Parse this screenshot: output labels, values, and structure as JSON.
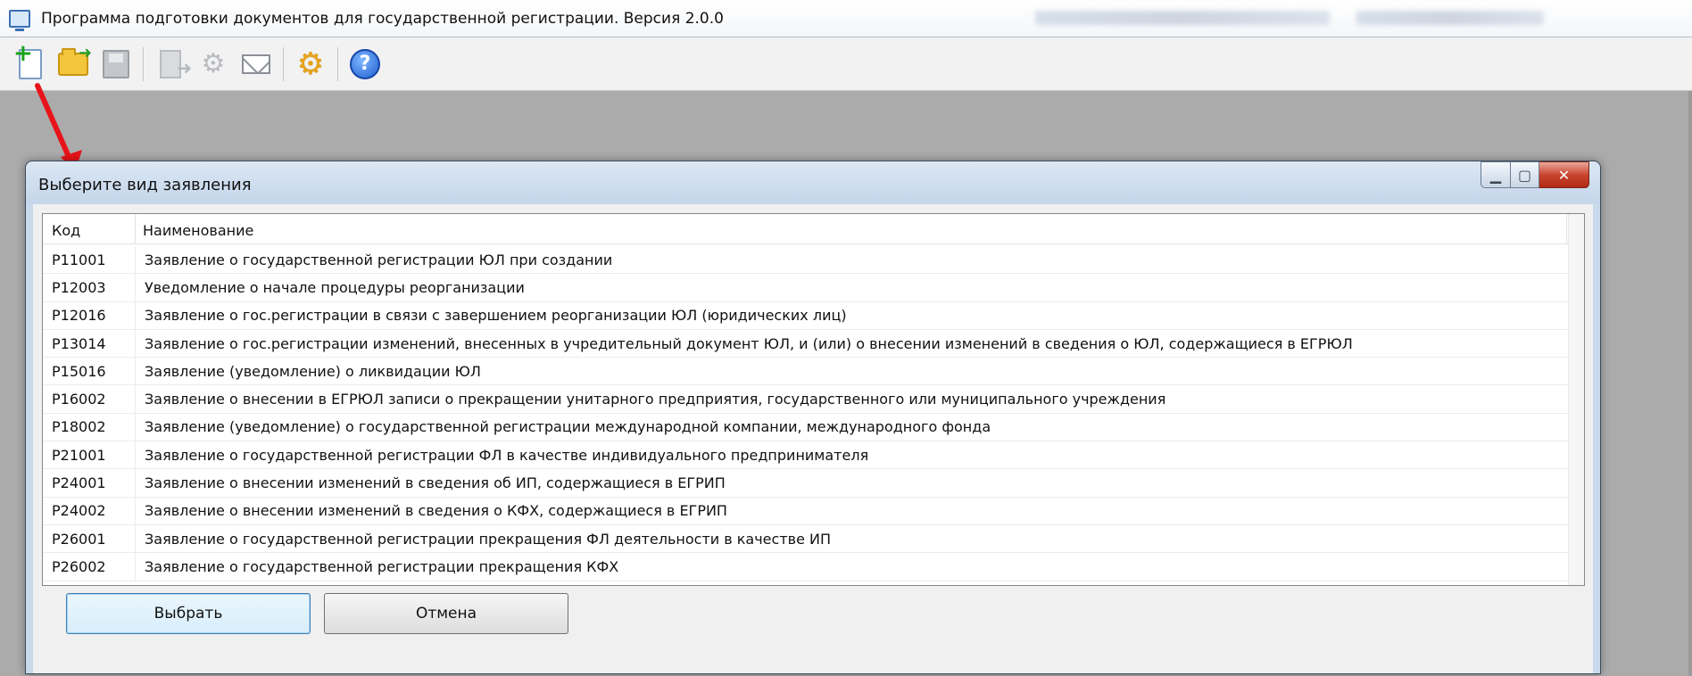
{
  "app": {
    "title": "Программа подготовки документов для государственной регистрации. Версия 2.0.0"
  },
  "toolbar": {
    "buttons": [
      {
        "icon": "new-document-icon"
      },
      {
        "icon": "open-folder-icon"
      },
      {
        "icon": "save-icon"
      },
      {
        "icon": "export-icon"
      },
      {
        "icon": "settings-disabled-icon"
      },
      {
        "icon": "mail-icon"
      },
      {
        "icon": "gear-icon"
      },
      {
        "icon": "help-icon"
      }
    ]
  },
  "annotation": {
    "color": "#e8141a"
  },
  "dialog": {
    "title": "Выберите вид заявления",
    "columns": {
      "code": "Код",
      "name": "Наименование"
    },
    "rows": [
      {
        "code": "Р11001",
        "name": "Заявление о государственной регистрации ЮЛ при создании"
      },
      {
        "code": "Р12003",
        "name": "Уведомление о начале процедуры реорганизации"
      },
      {
        "code": "Р12016",
        "name": "Заявление о гос.регистрации в связи с завершением реорганизации ЮЛ (юридических лиц)"
      },
      {
        "code": "Р13014",
        "name": "Заявление о гос.регистрации изменений, внесенных в учредительный документ ЮЛ, и (или) о внесении изменений в сведения о ЮЛ, содержащиеся в ЕГРЮЛ"
      },
      {
        "code": "Р15016",
        "name": "Заявление (уведомление) о ликвидации ЮЛ"
      },
      {
        "code": "Р16002",
        "name": "Заявление о внесении в ЕГРЮЛ записи о прекращении унитарного предприятия, государственного или муниципального учреждения"
      },
      {
        "code": "Р18002",
        "name": "Заявление (уведомление) о государственной регистрации международной компании, международного фонда"
      },
      {
        "code": "Р21001",
        "name": "Заявление о государственной регистрации ФЛ в качестве индивидуального предпринимателя"
      },
      {
        "code": "Р24001",
        "name": "Заявление о внесении изменений в сведения об ИП, содержащиеся в ЕГРИП"
      },
      {
        "code": "Р24002",
        "name": "Заявление о внесении изменений в сведения о КФХ, содержащиеся в ЕГРИП"
      },
      {
        "code": "Р26001",
        "name": "Заявление о государственной регистрации прекращения ФЛ деятельности в качестве ИП"
      },
      {
        "code": "Р26002",
        "name": "Заявление о государственной регистрации прекращения КФХ"
      }
    ],
    "select_label": "Выбрать",
    "cancel_label": "Отмена"
  }
}
